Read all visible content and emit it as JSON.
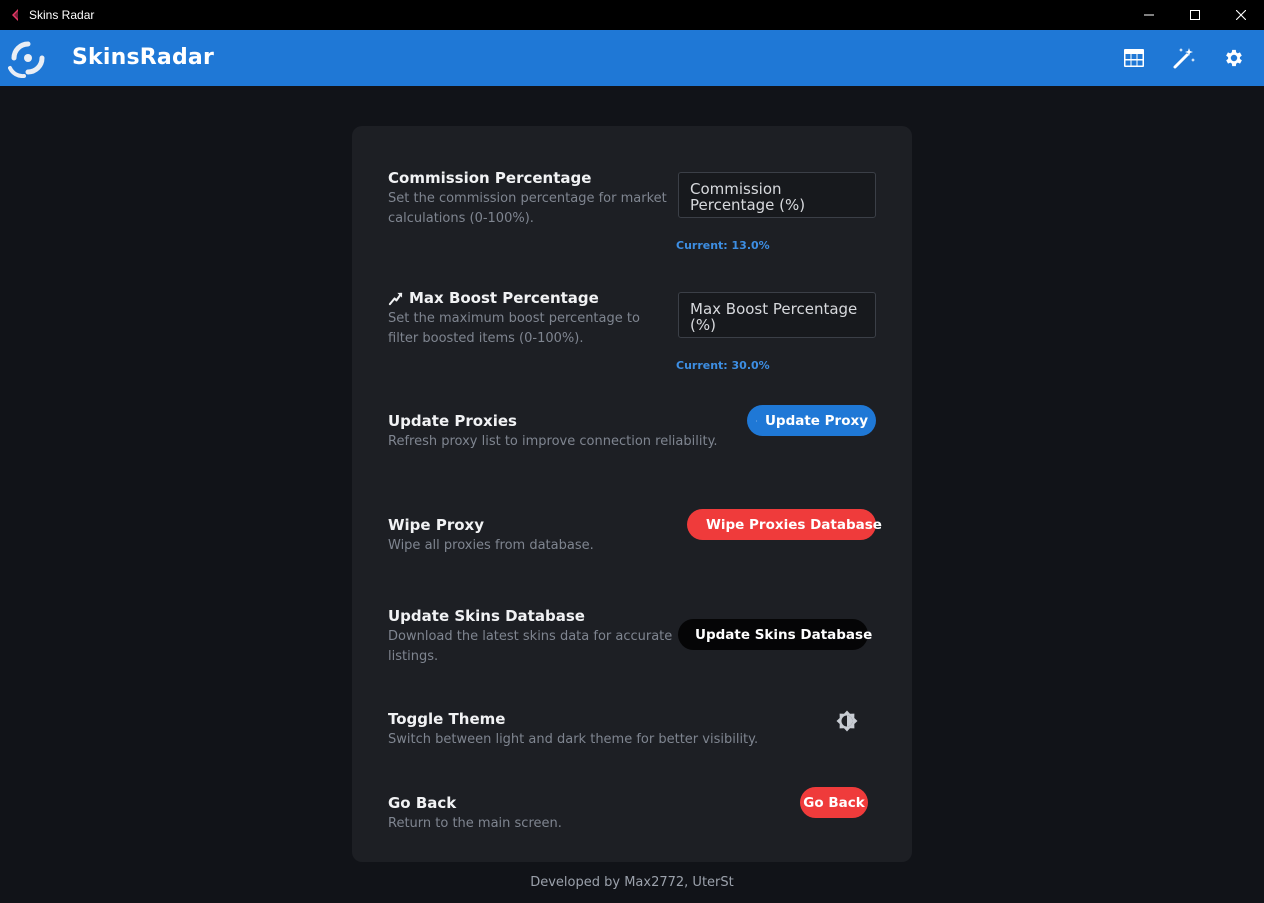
{
  "window": {
    "title": "Skins Radar"
  },
  "header": {
    "brand": "SkinsRadar"
  },
  "icons": {
    "app": "skins-radar-app-icon",
    "logo": "skinsradar-logo-icon",
    "table": "table-icon",
    "wand": "magic-wand-icon",
    "gear": "gear-icon"
  },
  "colors": {
    "accent": "#1f78d6",
    "danger": "#ef3b3b",
    "background": "#111318",
    "card": "#1d1f24",
    "current_text": "#3d8ee3"
  },
  "settings": {
    "commission": {
      "title": "Commission Percentage",
      "description": "Set the commission percentage for market calculations (0-100%).",
      "placeholder": "Commission Percentage (%)",
      "current": "Current: 13.0%"
    },
    "max_boost": {
      "title": "Max Boost Percentage",
      "description": "Set the maximum boost percentage to filter boosted items (0-100%).",
      "placeholder": "Max Boost Percentage (%)",
      "current": "Current: 30.0%"
    },
    "update_proxies": {
      "title": "Update Proxies",
      "description": "Refresh proxy list to improve connection reliability.",
      "button": "Update Proxy"
    },
    "wipe_proxy": {
      "title": "Wipe Proxy",
      "description": "Wipe all proxies from database.",
      "button": "Wipe Proxies Database"
    },
    "update_skins": {
      "title": "Update Skins Database",
      "description": "Download the latest skins data for accurate listings.",
      "button": "Update Skins Database"
    },
    "toggle_theme": {
      "title": "Toggle Theme",
      "description": "Switch between light and dark theme for better visibility."
    },
    "go_back": {
      "title": "Go Back",
      "description": "Return to the main screen.",
      "button": "Go Back"
    }
  },
  "footer": {
    "text": "Developed by Max2772, UterSt"
  }
}
